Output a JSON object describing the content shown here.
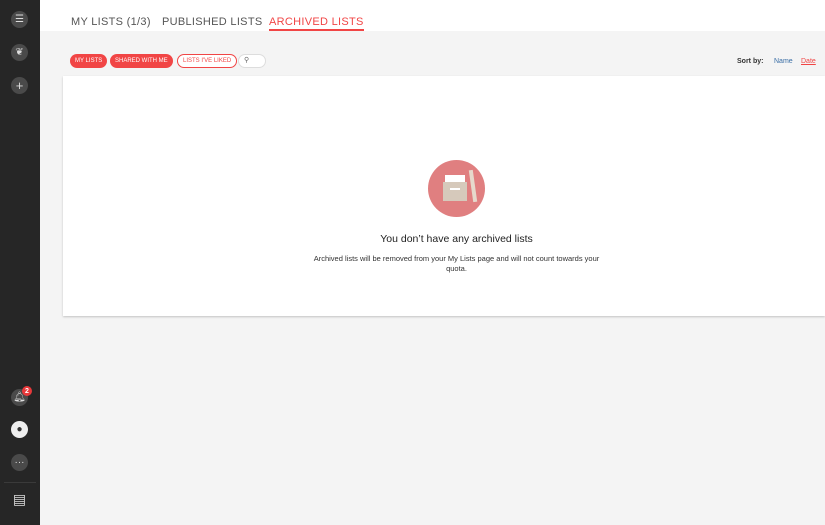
{
  "sidebar": {
    "items": [
      "menu-icon",
      "leaf-icon",
      "plus-icon",
      "bell-icon",
      "avatar",
      "more-icon",
      "book-icon"
    ],
    "notification_count": "2"
  },
  "tabs": [
    {
      "label": "MY LISTS (1/3)"
    },
    {
      "label": "PUBLISHED LISTS"
    },
    {
      "label": "ARCHIVED LISTS",
      "active": true
    }
  ],
  "filters": [
    {
      "label": "My lists"
    },
    {
      "label": "Shared with me"
    },
    {
      "label": "Lists I've liked"
    }
  ],
  "search": {
    "icon": "search-icon"
  },
  "sort": {
    "label": "Sort by:",
    "options": [
      "Name",
      "Date"
    ],
    "active": "Date"
  },
  "empty": {
    "title": "You don’t have any archived lists",
    "description": "Archived lists will be removed from your My Lists page and will not count towards your quota."
  },
  "colors": {
    "accent": "#f14545",
    "sidebar": "#262626",
    "illustration": "#e07f80"
  }
}
